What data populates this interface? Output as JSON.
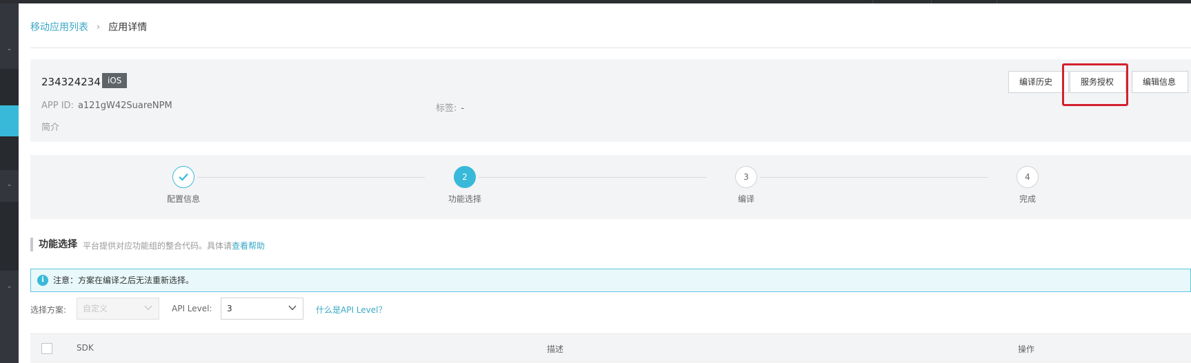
{
  "breadcrumb": {
    "parent": "移动应用列表",
    "separator": "›",
    "current": "应用详情"
  },
  "app": {
    "name": "234324234",
    "platform": "iOS",
    "app_id_label": "APP ID:",
    "app_id_value": "a121gW42SuareNPM",
    "tags_label": "标签:",
    "tags_value": "-",
    "intro_label": "简介"
  },
  "actions": {
    "build_history": "编译历史",
    "service_auth": "服务授权",
    "edit_info": "编辑信息"
  },
  "steps": [
    {
      "number": "1",
      "label": "配置信息",
      "state": "done"
    },
    {
      "number": "2",
      "label": "功能选择",
      "state": "current"
    },
    {
      "number": "3",
      "label": "编译",
      "state": "pending"
    },
    {
      "number": "4",
      "label": "完成",
      "state": "pending"
    }
  ],
  "section": {
    "title": "功能选择",
    "description": "平台提供对应功能组的整合代码。具体请",
    "help_link": "查看帮助"
  },
  "notice": {
    "icon": "info-icon",
    "text": "注意：方案在编译之后无法重新选择。"
  },
  "filters": {
    "scheme_label": "选择方案:",
    "scheme_value": "自定义",
    "api_level_label": "API Level:",
    "api_level_value": "3",
    "api_help_link": "什么是API Level？"
  },
  "table": {
    "columns": [
      "SDK",
      "描述",
      "操作"
    ]
  },
  "colors": {
    "accent": "#39b9d9",
    "link": "#39a7c5",
    "highlight": "#d3202e",
    "sidebar": "#33373d"
  }
}
